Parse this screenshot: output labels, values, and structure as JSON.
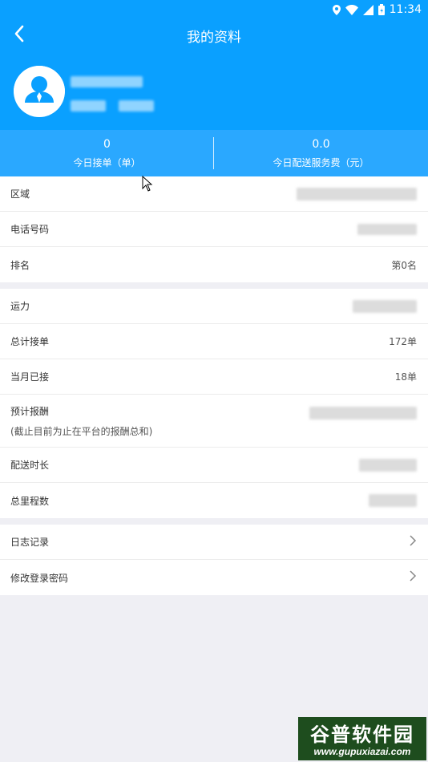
{
  "status_bar": {
    "time": "11:34"
  },
  "header": {
    "title": "我的资料"
  },
  "stats": [
    {
      "value": "0",
      "label": "今日接单（单）"
    },
    {
      "value": "0.0",
      "label": "今日配送服务费（元）"
    }
  ],
  "group1": [
    {
      "label": "区域",
      "value": ""
    },
    {
      "label": "电话号码",
      "value": ""
    },
    {
      "label": "排名",
      "value": "第0名"
    }
  ],
  "group2": [
    {
      "label": "运力",
      "value": ""
    },
    {
      "label": "总计接单",
      "value": "172单"
    },
    {
      "label": "当月已接",
      "value": "18单"
    },
    {
      "label": "预计报酬",
      "sublabel": "(截止目前为止在平台的报酬总和)",
      "value": ""
    },
    {
      "label": "配送时长",
      "value": ""
    },
    {
      "label": "总里程数",
      "value": ""
    }
  ],
  "group3": [
    {
      "label": "日志记录"
    },
    {
      "label": "修改登录密码"
    }
  ],
  "watermark": {
    "title": "谷普软件园",
    "url": "www.gupuxiazai.com"
  },
  "colors": {
    "primary": "#0aa0ff",
    "stats_bar": "#2aa8ff",
    "background": "#efeff4"
  },
  "icons": {
    "back": "chevron-left-icon",
    "avatar": "user-avatar-icon",
    "arrow": "chevron-right-icon"
  }
}
